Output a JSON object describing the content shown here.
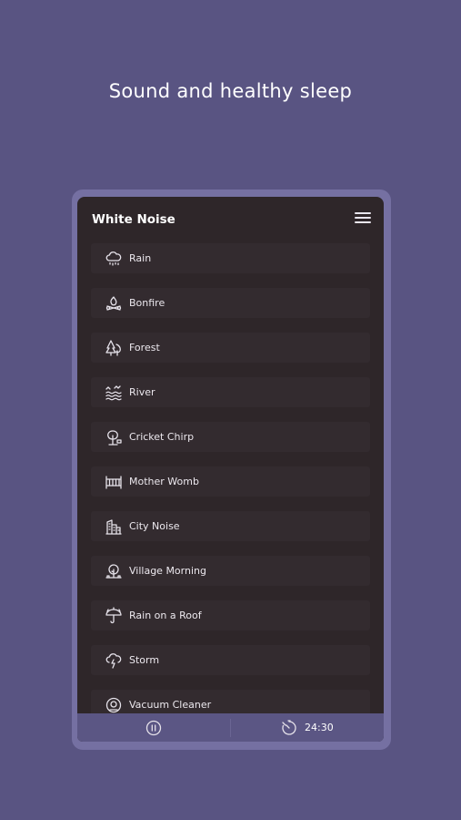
{
  "headline": "Sound and healthy sleep",
  "app": {
    "title": "White Noise",
    "menu_icon": "hamburger-menu-icon"
  },
  "sounds": [
    {
      "label": "Rain",
      "icon": "rain-cloud-icon"
    },
    {
      "label": "Bonfire",
      "icon": "campfire-icon"
    },
    {
      "label": "Forest",
      "icon": "trees-icon"
    },
    {
      "label": "River",
      "icon": "waves-icon"
    },
    {
      "label": "Cricket Chirp",
      "icon": "cricket-tree-icon"
    },
    {
      "label": "Mother Womb",
      "icon": "crib-icon"
    },
    {
      "label": "City Noise",
      "icon": "buildings-icon"
    },
    {
      "label": "Village Morning",
      "icon": "village-tree-icon"
    },
    {
      "label": "Rain on a Roof",
      "icon": "umbrella-rain-icon"
    },
    {
      "label": "Storm",
      "icon": "storm-cloud-icon"
    },
    {
      "label": "Vacuum Cleaner",
      "icon": "vacuum-cleaner-icon"
    }
  ],
  "controls": {
    "pause_icon": "pause-icon",
    "timer_icon": "timer-icon",
    "timer_value": "24:30"
  },
  "colors": {
    "background": "#595482",
    "device_frame": "#7570a2",
    "screen": "#2e2629",
    "list_item": "#332b2f",
    "control_bar": "#5b5684"
  }
}
